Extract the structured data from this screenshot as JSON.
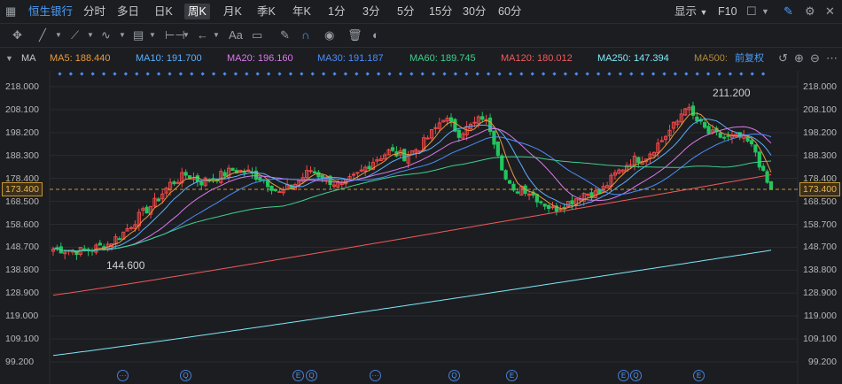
{
  "toolbar": {
    "stock_name": "恒生银行",
    "periods": [
      "分时",
      "多日",
      "日K",
      "周K",
      "月K",
      "季K",
      "年K",
      "1分",
      "3分",
      "5分",
      "15分",
      "30分",
      "60分"
    ],
    "active_period": "周K",
    "display_label": "显示",
    "f10_label": "F10"
  },
  "drawbar": {
    "text_tool": "Aa"
  },
  "indicators": {
    "main_label": "MA",
    "items": [
      {
        "label": "MA5: 188.440",
        "color": "#e89a3c"
      },
      {
        "label": "MA10: 191.700",
        "color": "#5ab0ff"
      },
      {
        "label": "MA20: 196.160",
        "color": "#d97ae8"
      },
      {
        "label": "MA30: 191.187",
        "color": "#4a8df8"
      },
      {
        "label": "MA60: 189.745",
        "color": "#3ecf8e"
      },
      {
        "label": "MA120: 180.012",
        "color": "#f05a5a"
      },
      {
        "label": "MA250: 147.394",
        "color": "#7ee8f8"
      },
      {
        "label": "MA500:",
        "color": "#b08a3a"
      }
    ],
    "adjust_label": "前复权"
  },
  "y_axis": [
    "218.000",
    "208.100",
    "198.200",
    "188.300",
    "178.400",
    "168.500",
    "158.600",
    "148.700",
    "138.800",
    "128.900",
    "119.000",
    "109.100",
    "99.200"
  ],
  "y_axis_right": [
    "218.000",
    "208.100",
    "198.200",
    "188.300",
    "178.400",
    "168.500",
    "158.700",
    "148.700",
    "138.800",
    "128.900",
    "119.000",
    "109.100",
    "99.200"
  ],
  "current_price": "173.400",
  "annotations": {
    "high": "211.200",
    "low": "144.600"
  },
  "events": [
    "···",
    "Q",
    "E",
    "Q",
    "···",
    "Q",
    "E",
    "E",
    "Q",
    "E"
  ],
  "colors": {
    "up": "#f04848",
    "down": "#22c55e",
    "bg": "#1c1d21"
  }
}
